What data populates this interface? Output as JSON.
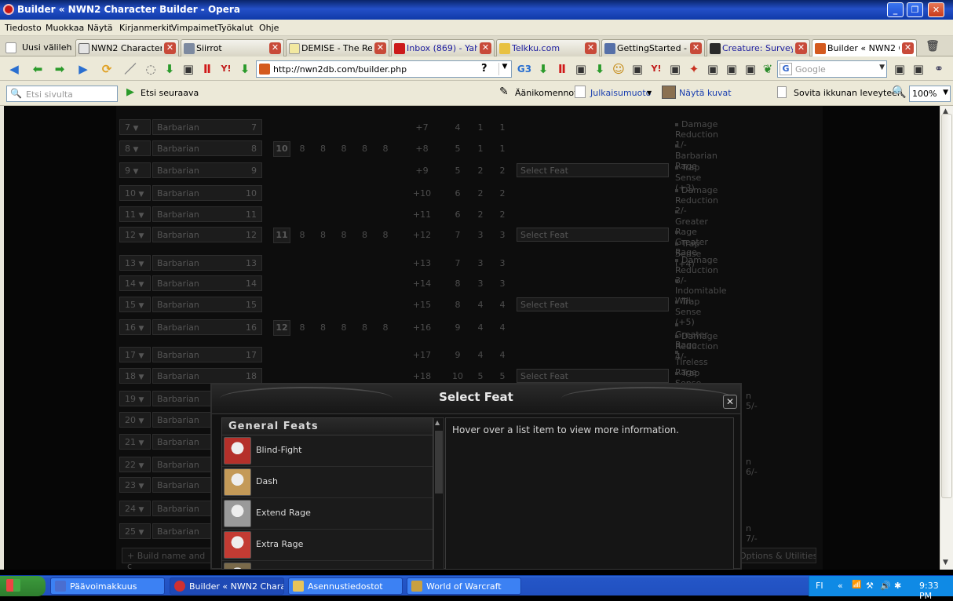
{
  "window": {
    "title": "Builder « NWN2 Character Builder - Opera"
  },
  "menu": [
    "Tiedosto",
    "Muokkaa",
    "Näytä",
    "Kirjanmerkit",
    "Vimpaimet",
    "Työkalut",
    "Ohje"
  ],
  "tabs": [
    {
      "label": "Uusi välilehti",
      "icon_color": "#ffffff"
    },
    {
      "label": "NWN2 Character ...",
      "icon_color": "#e4e4e4"
    },
    {
      "label": "Siirrot",
      "icon_color": "#7d8aa0"
    },
    {
      "label": "DEMISE - The Re...",
      "icon_color": "#f2e8a0"
    },
    {
      "label": "Inbox (869) - Yah...",
      "icon_color": "#cc1a1a"
    },
    {
      "label": "Telkku.com",
      "icon_color": "#e8c140"
    },
    {
      "label": "GettingStarted - ...",
      "icon_color": "#5670a8"
    },
    {
      "label": "Creature: Survey...",
      "icon_color": "#2a2a2a"
    },
    {
      "label": "Builder « NWN2 C...",
      "icon_color": "#d45a1e"
    }
  ],
  "address": {
    "url": "http://nwn2db.com/builder.php",
    "search_placeholder": "Google"
  },
  "findbar": {
    "find_placeholder": "Etsi sivulta",
    "find_next": "Etsi seuraava",
    "voice": "Äänikomennot",
    "publish": "Julkaisumuoto",
    "show_images": "Näytä kuvat",
    "fit_width": "Sovita ikkunan leveyteen",
    "zoom": "100%"
  },
  "levels": [
    {
      "num": "7",
      "class": "Barbarian",
      "clvl": "7",
      "bab": "+7",
      "fort": "4",
      "ref": "1",
      "will": "1",
      "feat_gained": [
        "Damage Reduction 1/-"
      ]
    },
    {
      "num": "8",
      "class": "Barbarian",
      "clvl": "8",
      "ability": "10",
      "stats": [
        "8",
        "8",
        "8",
        "8",
        "8"
      ],
      "bab": "+8",
      "fort": "5",
      "ref": "1",
      "will": "1",
      "feat_gained": [
        "Barbarian Rage"
      ]
    },
    {
      "num": "9",
      "class": "Barbarian",
      "clvl": "9",
      "bab": "+9",
      "fort": "5",
      "ref": "2",
      "will": "2",
      "select": "Select Feat",
      "feat_gained": [
        "Trap Sense (+3)"
      ]
    },
    {
      "num": "10",
      "class": "Barbarian",
      "clvl": "10",
      "bab": "+10",
      "fort": "6",
      "ref": "2",
      "will": "2",
      "feat_gained": [
        "Damage Reduction 2/-"
      ]
    },
    {
      "num": "11",
      "class": "Barbarian",
      "clvl": "11",
      "bab": "+11",
      "fort": "6",
      "ref": "2",
      "will": "2",
      "feat_gained": [
        "Greater Rage"
      ]
    },
    {
      "num": "12",
      "class": "Barbarian",
      "clvl": "12",
      "ability": "11",
      "stats": [
        "8",
        "8",
        "8",
        "8",
        "8"
      ],
      "bab": "+12",
      "fort": "7",
      "ref": "3",
      "will": "3",
      "select": "Select Feat",
      "feat_gained": [
        "Greater Rage",
        "Trap Sense (+4)"
      ]
    },
    {
      "num": "13",
      "class": "Barbarian",
      "clvl": "13",
      "bab": "+13",
      "fort": "7",
      "ref": "3",
      "will": "3",
      "feat_gained": [
        "Damage Reduction 3/-"
      ]
    },
    {
      "num": "14",
      "class": "Barbarian",
      "clvl": "14",
      "bab": "+14",
      "fort": "8",
      "ref": "3",
      "will": "3",
      "feat_gained": [
        "Indomitable Will"
      ]
    },
    {
      "num": "15",
      "class": "Barbarian",
      "clvl": "15",
      "bab": "+15",
      "fort": "8",
      "ref": "4",
      "will": "4",
      "select": "Select Feat",
      "feat_gained": [
        "Trap Sense (+5)"
      ]
    },
    {
      "num": "16",
      "class": "Barbarian",
      "clvl": "16",
      "ability": "12",
      "stats": [
        "8",
        "8",
        "8",
        "8",
        "8"
      ],
      "bab": "+16",
      "fort": "9",
      "ref": "4",
      "will": "4",
      "feat_gained": [
        "Greater Rage",
        "Damage Reduction 4/-"
      ]
    },
    {
      "num": "17",
      "class": "Barbarian",
      "clvl": "17",
      "bab": "+17",
      "fort": "9",
      "ref": "4",
      "will": "4",
      "feat_gained": [
        "Tireless Rage"
      ]
    },
    {
      "num": "18",
      "class": "Barbarian",
      "clvl": "18",
      "bab": "+18",
      "fort": "10",
      "ref": "5",
      "will": "5",
      "select": "Select Feat",
      "feat_gained": [
        "Trap Sense (+6)"
      ]
    },
    {
      "num": "19",
      "class": "Barbarian",
      "clvl": "19",
      "feat_gained": [
        "n 5/-"
      ]
    },
    {
      "num": "20",
      "class": "Barbarian",
      "clvl": "20",
      "feat_gained": []
    },
    {
      "num": "21",
      "class": "Barbarian",
      "clvl": "21",
      "feat_gained": []
    },
    {
      "num": "22",
      "class": "Barbarian",
      "clvl": "22",
      "feat_gained": [
        "n 6/-"
      ]
    },
    {
      "num": "23",
      "class": "Barbarian",
      "clvl": "23",
      "feat_gained": []
    },
    {
      "num": "24",
      "class": "Barbarian",
      "clvl": "24",
      "feat_gained": []
    },
    {
      "num": "25",
      "class": "Barbarian",
      "clvl": "25",
      "feat_gained": [
        "n 7/-"
      ]
    }
  ],
  "footer": {
    "build_name": "Build name and c",
    "options": "Options & Utilities"
  },
  "dialog": {
    "title": "Select Feat",
    "category": "General Feats",
    "feats": [
      {
        "name": "Blind-Fight",
        "icon_color": "#b5302a"
      },
      {
        "name": "Dash",
        "icon_color": "#c49a58"
      },
      {
        "name": "Extend Rage",
        "icon_color": "#9a9a9a"
      },
      {
        "name": "Extra Rage",
        "icon_color": "#c33b33"
      },
      {
        "name": "",
        "icon_color": "#7a6a4a"
      }
    ],
    "info": "Hover over a list item to view more information."
  },
  "taskbar": {
    "start": "start",
    "tasks": [
      {
        "label": "Päävoimakkuus",
        "icon_color": "#4a6ed0"
      },
      {
        "label": "Builder « NWN2 Chara...",
        "icon_color": "#d03030"
      },
      {
        "label": "Asennustiedostot",
        "icon_color": "#e8c45a"
      },
      {
        "label": "World of Warcraft",
        "icon_color": "#c8a040"
      }
    ],
    "lang": "FI",
    "time": "9:33 PM"
  }
}
